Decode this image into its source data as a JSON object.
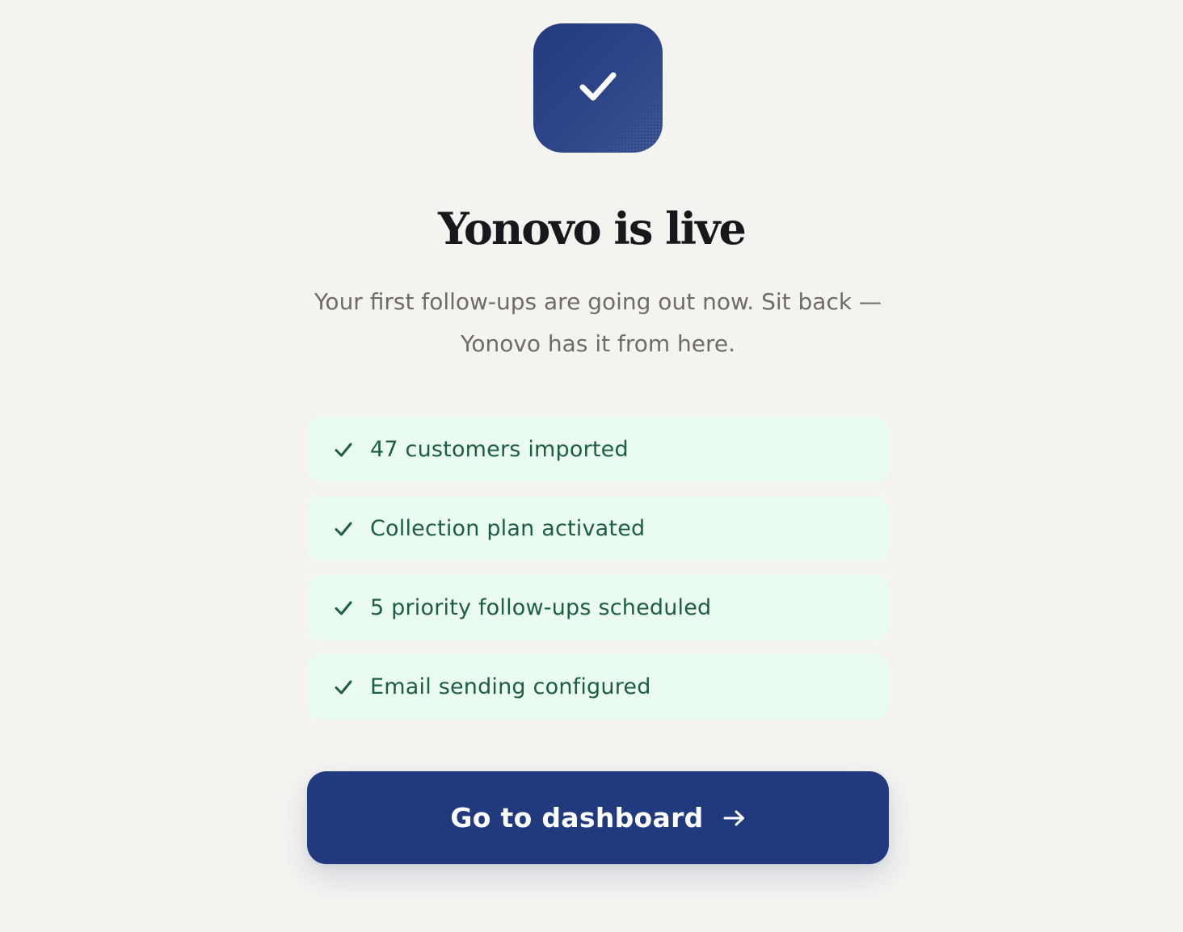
{
  "hero": {
    "icon": "check-icon",
    "title": "Yonovo is live",
    "subtitle": "Your first follow-ups are going out now. Sit back — Yonovo has it from here."
  },
  "checklist": {
    "icon": "check-icon",
    "items": [
      {
        "label": "47 customers imported"
      },
      {
        "label": "Collection plan activated"
      },
      {
        "label": "5 priority follow-ups scheduled"
      },
      {
        "label": "Email sending configured"
      }
    ]
  },
  "cta": {
    "label": "Go to dashboard",
    "icon": "arrow-right-icon"
  },
  "colors": {
    "background": "#f4f3f0",
    "brand": "#213a7e",
    "success_bg": "#eafbf2",
    "success_text": "#1b5e43",
    "heading": "#16181c",
    "muted": "#6f6c67"
  }
}
